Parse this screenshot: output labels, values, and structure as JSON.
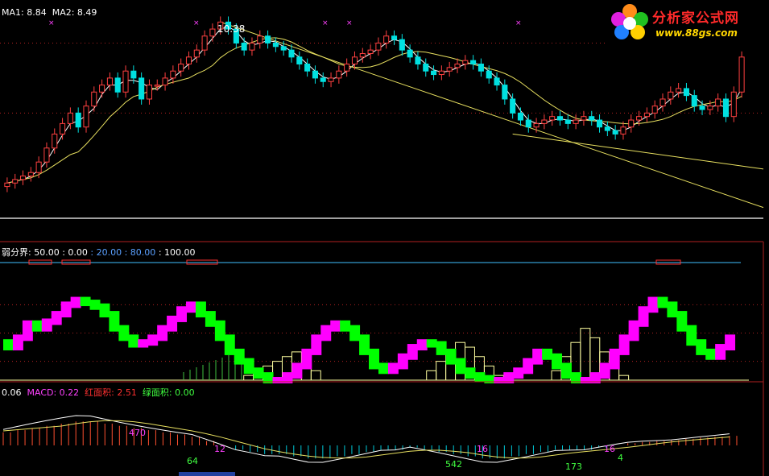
{
  "colors": {
    "up": "#ff4040",
    "down": "#00e0e0",
    "ma1": "#ffffff",
    "ma2": "#e8e060",
    "trend": "#e8e060",
    "grid": "#b02020",
    "ind_up": "#ff00ff",
    "ind_down": "#00ff00",
    "hist": "#ffffa0",
    "macd_pos": "#ff5030",
    "macd_neg": "#00c8d8",
    "axis_sep": "#a0a0a0",
    "level_line": "#40c0ff"
  },
  "legends": {
    "main": [
      {
        "text": "MA1: 8.84",
        "color": "#ffffff"
      },
      {
        "text": "MA2: 8.49",
        "color": "#ffffff"
      }
    ],
    "mid": [
      {
        "text": "弱分界: 50.00",
        "color": "#ffffff"
      },
      {
        "text": ": 0.00",
        "color": "#ffffff"
      },
      {
        "text": ": 20.00",
        "color": "#5aa0ff"
      },
      {
        "text": ": 80.00",
        "color": "#5aa0ff"
      },
      {
        "text": ": 100.00",
        "color": "#ffffff"
      }
    ],
    "macd": [
      {
        "text": "0.06",
        "color": "#ffffff"
      },
      {
        "text": "MACD: 0.22",
        "color": "#ff40ff"
      },
      {
        "text": "红面积: 2.51",
        "color": "#ff3030"
      },
      {
        "text": "绿面积: 0.00",
        "color": "#40ff40"
      }
    ]
  },
  "annotations": {
    "peak": "10.38",
    "macd_numbers": [
      {
        "text": "470",
        "color": "#ff40ff"
      },
      {
        "text": "12",
        "color": "#ff40ff"
      },
      {
        "text": "64",
        "color": "#40ff40"
      },
      {
        "text": "16",
        "color": "#ff40ff"
      },
      {
        "text": "542",
        "color": "#40ff40"
      },
      {
        "text": "16",
        "color": "#ff40ff"
      },
      {
        "text": "173",
        "color": "#40ff40"
      },
      {
        "text": "4",
        "color": "#40ff40"
      }
    ]
  },
  "logo": {
    "brand": "分析家公式网",
    "url": "www.88gs.com"
  },
  "chart_data": [
    {
      "type": "candlestick",
      "title": "",
      "series": [
        {
          "name": "MA1",
          "values": "computed"
        },
        {
          "name": "MA2",
          "values": "computed"
        }
      ],
      "ylim": [
        7.6,
        10.5
      ],
      "close": [
        8.0,
        8.05,
        8.1,
        8.15,
        8.3,
        8.5,
        8.7,
        8.85,
        9.0,
        8.8,
        9.1,
        9.3,
        9.4,
        9.5,
        9.3,
        9.6,
        9.5,
        9.2,
        9.4,
        9.4,
        9.5,
        9.6,
        9.7,
        9.8,
        9.9,
        10.1,
        10.2,
        10.3,
        10.2,
        10.0,
        9.9,
        10.0,
        10.1,
        10.0,
        9.95,
        9.9,
        9.8,
        9.7,
        9.6,
        9.5,
        9.45,
        9.5,
        9.6,
        9.7,
        9.8,
        9.85,
        9.9,
        10.0,
        10.1,
        10.05,
        9.9,
        9.8,
        9.7,
        9.6,
        9.55,
        9.6,
        9.65,
        9.7,
        9.75,
        9.7,
        9.6,
        9.5,
        9.4,
        9.2,
        9.0,
        8.9,
        8.8,
        8.85,
        8.9,
        8.95,
        8.9,
        8.85,
        8.9,
        8.95,
        8.9,
        8.8,
        8.75,
        8.7,
        8.8,
        8.9,
        8.95,
        9.0,
        9.1,
        9.2,
        9.3,
        9.35,
        9.25,
        9.1,
        9.05,
        9.1,
        9.2,
        8.95,
        9.3,
        9.8
      ],
      "open": [
        7.95,
        8.0,
        8.05,
        8.1,
        8.15,
        8.3,
        8.5,
        8.7,
        8.85,
        9.0,
        8.8,
        9.1,
        9.3,
        9.4,
        9.5,
        9.3,
        9.6,
        9.5,
        9.2,
        9.4,
        9.4,
        9.5,
        9.6,
        9.7,
        9.8,
        9.9,
        10.1,
        10.2,
        10.3,
        10.2,
        10.0,
        9.9,
        10.0,
        10.1,
        10.0,
        9.95,
        9.9,
        9.8,
        9.7,
        9.6,
        9.5,
        9.45,
        9.5,
        9.6,
        9.7,
        9.8,
        9.85,
        9.9,
        10.0,
        10.1,
        10.05,
        9.9,
        9.8,
        9.7,
        9.6,
        9.55,
        9.6,
        9.65,
        9.7,
        9.75,
        9.7,
        9.6,
        9.5,
        9.4,
        9.2,
        9.0,
        8.9,
        8.8,
        8.85,
        8.9,
        8.95,
        8.9,
        8.85,
        8.9,
        8.95,
        8.9,
        8.8,
        8.75,
        8.7,
        8.8,
        8.9,
        8.95,
        9.0,
        9.1,
        9.2,
        9.3,
        9.35,
        9.25,
        9.1,
        9.05,
        9.1,
        9.2,
        8.95,
        9.3
      ]
    },
    {
      "type": "bar",
      "title": "",
      "ylim": [
        0,
        100
      ],
      "levels": [
        0,
        20,
        50,
        80,
        100
      ],
      "osc": [
        40,
        35,
        45,
        60,
        55,
        62,
        70,
        80,
        85,
        82,
        78,
        70,
        55,
        45,
        38,
        40,
        45,
        55,
        65,
        75,
        80,
        70,
        60,
        45,
        30,
        20,
        10,
        5,
        0,
        0,
        5,
        15,
        30,
        45,
        55,
        60,
        55,
        45,
        30,
        15,
        10,
        15,
        25,
        35,
        40,
        38,
        30,
        20,
        10,
        5,
        2,
        0,
        0,
        5,
        10,
        20,
        30,
        25,
        15,
        5,
        0,
        0,
        5,
        15,
        30,
        45,
        60,
        75,
        85,
        80,
        70,
        55,
        40,
        30,
        25,
        35,
        45
      ],
      "hist": [
        0,
        0,
        0,
        0,
        0,
        0,
        0,
        0,
        0,
        0,
        0,
        0,
        0,
        0,
        0,
        0,
        0,
        0,
        0,
        0,
        0,
        0,
        0,
        0,
        0,
        5,
        10,
        15,
        20,
        25,
        30,
        20,
        10,
        0,
        0,
        0,
        0,
        0,
        0,
        0,
        0,
        0,
        0,
        0,
        10,
        20,
        30,
        40,
        35,
        25,
        15,
        5,
        0,
        0,
        0,
        0,
        0,
        10,
        25,
        40,
        55,
        45,
        30,
        15,
        5,
        0,
        0,
        0,
        0,
        0,
        0,
        0,
        0,
        0,
        0,
        0,
        0
      ]
    },
    {
      "type": "bar",
      "title": "",
      "series": [
        {
          "name": "MACD",
          "values": [
            0.3,
            0.35,
            0.4,
            0.45,
            0.5,
            0.55,
            0.55,
            0.5,
            0.45,
            0.4,
            0.35,
            0.3,
            0.25,
            0.2,
            0.1,
            0.0,
            -0.1,
            -0.15,
            -0.2,
            -0.2,
            -0.25,
            -0.3,
            -0.3,
            -0.25,
            -0.2,
            -0.15,
            -0.1,
            -0.1,
            -0.05,
            -0.1,
            -0.15,
            -0.2,
            -0.25,
            -0.3,
            -0.3,
            -0.25,
            -0.2,
            -0.15,
            -0.1,
            -0.1,
            -0.1,
            -0.05,
            0.0,
            0.05,
            0.08,
            0.1,
            0.12,
            0.15,
            0.18,
            0.2,
            0.22
          ]
        }
      ]
    }
  ]
}
